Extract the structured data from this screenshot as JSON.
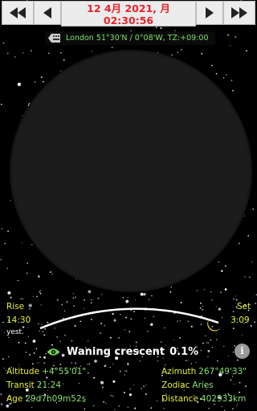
{
  "header": {
    "date": "12 4月 2021, 月",
    "time": "02:30:56",
    "buttons": {
      "fast_back": "double-left-icon",
      "back": "left-icon",
      "forward": "right-icon",
      "fast_forward": "double-right-icon"
    }
  },
  "location": {
    "icon": "keyboard-icon",
    "text": "London  51°30'N  /  0°08'W, TZ:+09:00"
  },
  "moon": {
    "rise_label": "Rise",
    "rise_time": "14:30",
    "rise_note": "yest.",
    "set_label": "Set",
    "set_time": "3:09",
    "phase_icon": "eye-icon",
    "phase_name": "Waning crescent",
    "phase_percent": "0.1%",
    "info_icon": "info-icon",
    "info_glyph": "i",
    "altitude_label": "Altitude",
    "altitude_value": "+4°55'01\"",
    "transit_label": "Transit",
    "transit_value": "21:24",
    "age_label": "Age",
    "age_value": "29d7h09m52s",
    "azimuth_label": "Azimuth",
    "azimuth_value": "267°49'33\"",
    "zodiac_label": "Zodiac",
    "zodiac_value": "Aries",
    "distance_label": "Distance",
    "distance_value": "402933km"
  },
  "colors": {
    "accent_red": "#e8222a",
    "label_yellow": "#e8f23a",
    "value_green": "#8be36e"
  }
}
